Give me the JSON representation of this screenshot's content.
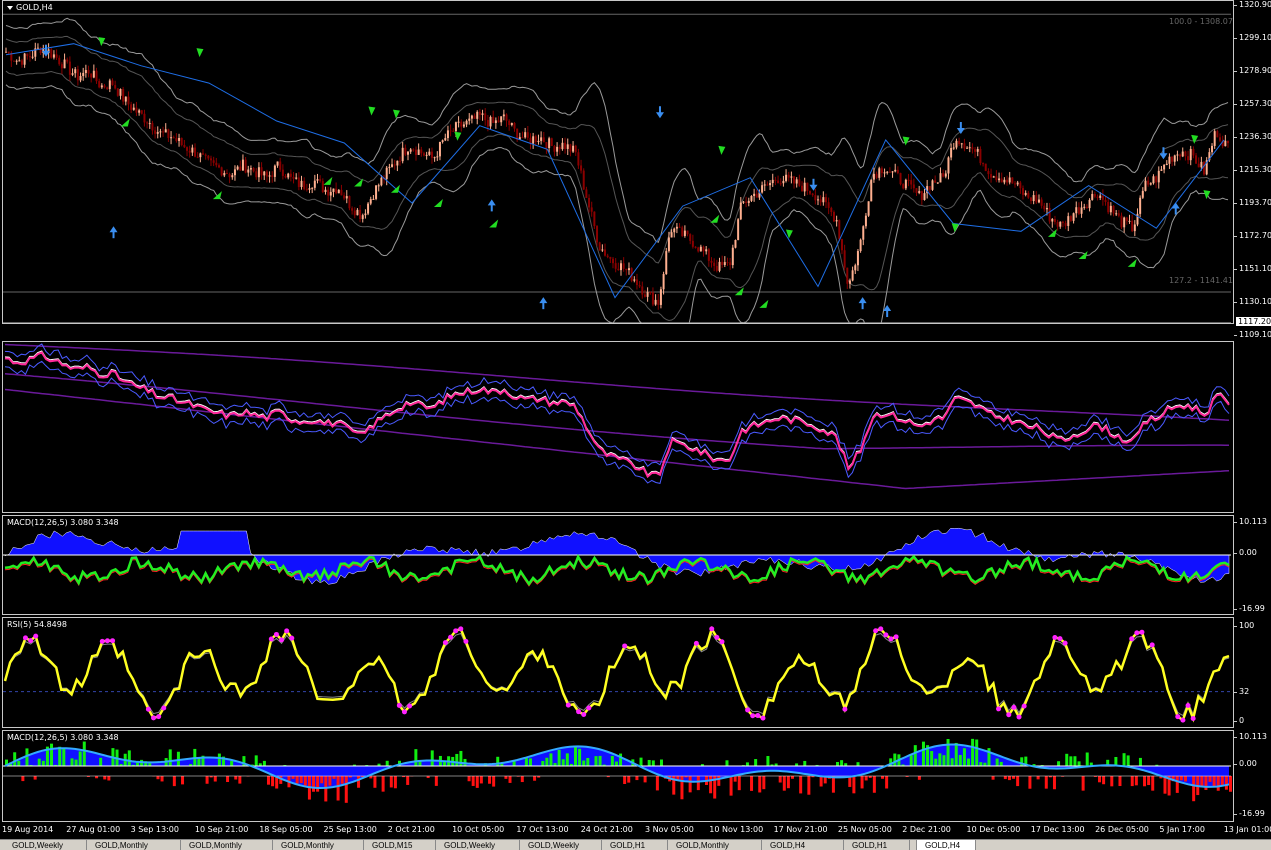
{
  "main_chart": {
    "title": "GOLD,H4",
    "fib_upper_label": "100.0 - 1308.07",
    "fib_lower_label": "127.2 - 1141.41",
    "current_price": "1117.20",
    "price_ticks": [
      "1320.90",
      "1299.10",
      "1278.90",
      "1257.30",
      "1236.30",
      "1215.30",
      "1193.70",
      "1172.70",
      "1151.10",
      "1130.10",
      "1109.10"
    ],
    "price_range": [
      1109.1,
      1320.9
    ],
    "price_path": [
      1292,
      1286,
      1289,
      1295,
      1290,
      1283,
      1276,
      1280,
      1270,
      1272,
      1261,
      1254,
      1248,
      1240,
      1238,
      1232,
      1228,
      1221,
      1218,
      1214,
      1220,
      1216,
      1212,
      1220,
      1211,
      1207,
      1210,
      1204,
      1206,
      1195,
      1188,
      1203,
      1214,
      1224,
      1233,
      1228,
      1224,
      1237,
      1244,
      1247,
      1251,
      1246,
      1250,
      1240,
      1236,
      1238,
      1232,
      1233,
      1228,
      1198,
      1169,
      1160,
      1155,
      1148,
      1138,
      1133,
      1180,
      1176,
      1171,
      1163,
      1155,
      1157,
      1195,
      1201,
      1206,
      1212,
      1210,
      1207,
      1203,
      1195,
      1186,
      1143,
      1170,
      1214,
      1219,
      1213,
      1207,
      1200,
      1209,
      1212,
      1238,
      1233,
      1226,
      1215,
      1212,
      1208,
      1200,
      1198,
      1187,
      1181,
      1190,
      1196,
      1203,
      1193,
      1184,
      1180,
      1207,
      1212,
      1224,
      1229,
      1226,
      1216,
      1242,
      1231
    ],
    "zigzag": [
      1290,
      1297,
      1283,
      1272,
      1248,
      1234,
      1196,
      1245,
      1230,
      1136,
      1194,
      1212,
      1143,
      1236,
      1183,
      1178,
      1207,
      1180,
      1236
    ],
    "up_arrows": [
      [
        0.09,
        1180
      ],
      [
        0.398,
        1197
      ],
      [
        0.44,
        1135
      ],
      [
        0.7,
        1135
      ],
      [
        0.72,
        1130
      ],
      [
        0.955,
        1195
      ]
    ],
    "down_arrows": [
      [
        0.035,
        1290
      ],
      [
        0.535,
        1251
      ],
      [
        0.66,
        1205
      ],
      [
        0.78,
        1241
      ],
      [
        0.945,
        1225
      ]
    ],
    "green_arrow_ups": [
      [
        0.1,
        1247
      ],
      [
        0.175,
        1201
      ],
      [
        0.265,
        1210
      ],
      [
        0.29,
        1209
      ],
      [
        0.32,
        1205
      ],
      [
        0.355,
        1196
      ],
      [
        0.4,
        1183
      ],
      [
        0.58,
        1186
      ],
      [
        0.6,
        1140
      ],
      [
        0.62,
        1132
      ],
      [
        0.855,
        1177
      ],
      [
        0.88,
        1163
      ],
      [
        0.92,
        1158
      ]
    ],
    "green_arrow_downs": [
      [
        0.08,
        1298
      ],
      [
        0.16,
        1291
      ],
      [
        0.3,
        1254
      ],
      [
        0.32,
        1252
      ],
      [
        0.37,
        1238
      ],
      [
        0.585,
        1229
      ],
      [
        0.64,
        1176
      ],
      [
        0.735,
        1235
      ],
      [
        0.775,
        1180
      ],
      [
        0.97,
        1236
      ],
      [
        0.98,
        1201
      ]
    ]
  },
  "ma_panel": {
    "label": ""
  },
  "macd_panel_1": {
    "label": "MACD(12,26,5) 3.080 3.348",
    "ticks": [
      "10.113",
      "0.00",
      "-16.99"
    ],
    "marker": "a"
  },
  "rsi_panel": {
    "label": "RSI(5) 54.8498",
    "ticks": [
      "100",
      "32",
      "0"
    ]
  },
  "macd_panel_2": {
    "label": "MACD(12,26,5) 3.080 3.348",
    "ticks": [
      "10.113",
      "0.00",
      "-16.99"
    ]
  },
  "time_axis": [
    "19 Aug 2014",
    "27 Aug 01:00",
    "3 Sep 13:00",
    "10 Sep 21:00",
    "18 Sep 05:00",
    "25 Sep 13:00",
    "2 Oct 21:00",
    "10 Oct 05:00",
    "17 Oct 13:00",
    "24 Oct 21:00",
    "3 Nov 05:00",
    "10 Nov 13:00",
    "17 Nov 21:00",
    "25 Nov 05:00",
    "2 Dec 21:00",
    "10 Dec 05:00",
    "17 Dec 13:00",
    "26 Dec 05:00",
    "5 Jan 17:00",
    "13 Jan 01:00"
  ],
  "tabs": [
    "GOLD,Weekly",
    "GOLD,Monthly",
    "GOLD,Monthly",
    "GOLD,Monthly",
    "GOLD,M15",
    "GOLD,Weekly",
    "GOLD,Weekly",
    "GOLD,H1",
    "GOLD,Monthly",
    "GOLD,H4",
    "GOLD,H1",
    "GOLD,H4"
  ],
  "active_tab_index": 11,
  "colors": {
    "bull_candle": "#8b0000",
    "bear_candle": "#ffb090",
    "bands": "#9a9a9a",
    "zigzag": "#1e6ee6",
    "green_arrow": "#22dd22",
    "blue_arrow": "#3a8ef0",
    "macd_blue_fill": "#1010ff",
    "macd_green": "#22ee22",
    "rsi_yellow": "#ffff22",
    "rsi_magenta": "#ff22ff",
    "hist_green": "#11ee11",
    "hist_red": "#ff1111",
    "ma_pink": "#ff2a9a",
    "ma_purple": "#6a1a9a",
    "ma_blue": "#4a5aff"
  }
}
